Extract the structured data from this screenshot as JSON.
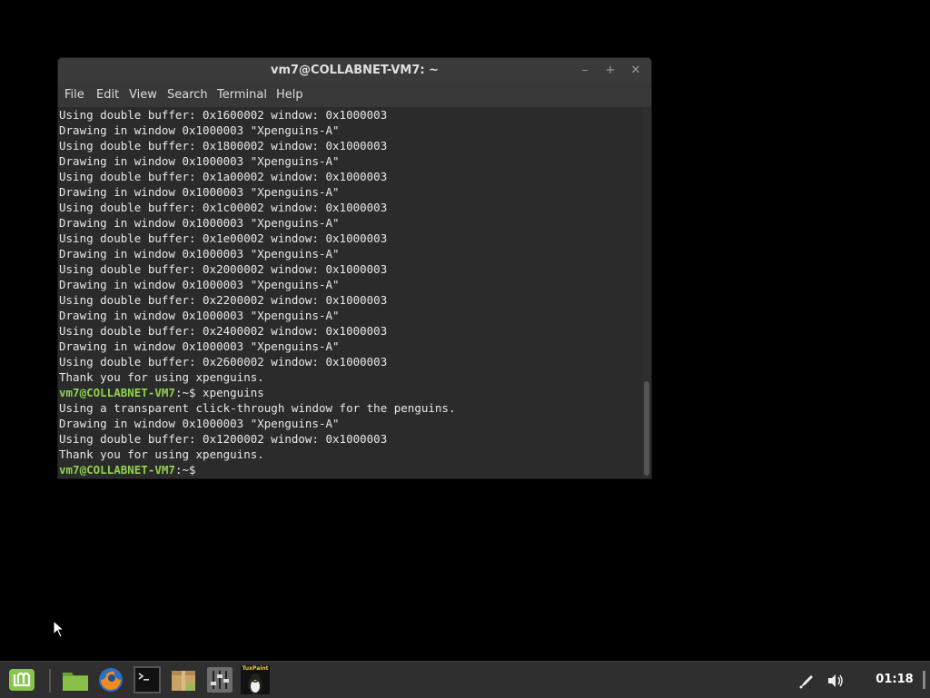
{
  "window": {
    "title": "vm7@COLLABNET-VM7: ~",
    "controls": {
      "minimize": "–",
      "maximize": "+",
      "close": "✕"
    }
  },
  "menu": [
    "File",
    "Edit",
    "View",
    "Search",
    "Terminal",
    "Help"
  ],
  "terminal": {
    "lines": [
      {
        "prompt": "",
        "text": "Using double buffer: 0x1600002 window: 0x1000003"
      },
      {
        "prompt": "",
        "text": "Drawing in window 0x1000003 \"Xpenguins-A\""
      },
      {
        "prompt": "",
        "text": "Using double buffer: 0x1800002 window: 0x1000003"
      },
      {
        "prompt": "",
        "text": "Drawing in window 0x1000003 \"Xpenguins-A\""
      },
      {
        "prompt": "",
        "text": "Using double buffer: 0x1a00002 window: 0x1000003"
      },
      {
        "prompt": "",
        "text": "Drawing in window 0x1000003 \"Xpenguins-A\""
      },
      {
        "prompt": "",
        "text": "Using double buffer: 0x1c00002 window: 0x1000003"
      },
      {
        "prompt": "",
        "text": "Drawing in window 0x1000003 \"Xpenguins-A\""
      },
      {
        "prompt": "",
        "text": "Using double buffer: 0x1e00002 window: 0x1000003"
      },
      {
        "prompt": "",
        "text": "Drawing in window 0x1000003 \"Xpenguins-A\""
      },
      {
        "prompt": "",
        "text": "Using double buffer: 0x2000002 window: 0x1000003"
      },
      {
        "prompt": "",
        "text": "Drawing in window 0x1000003 \"Xpenguins-A\""
      },
      {
        "prompt": "",
        "text": "Using double buffer: 0x2200002 window: 0x1000003"
      },
      {
        "prompt": "",
        "text": "Drawing in window 0x1000003 \"Xpenguins-A\""
      },
      {
        "prompt": "",
        "text": "Using double buffer: 0x2400002 window: 0x1000003"
      },
      {
        "prompt": "",
        "text": "Drawing in window 0x1000003 \"Xpenguins-A\""
      },
      {
        "prompt": "",
        "text": "Using double buffer: 0x2600002 window: 0x1000003"
      },
      {
        "prompt": "",
        "text": "Thank you for using xpenguins."
      },
      {
        "prompt": "vm7@COLLABNET-VM7",
        "text": ":~$ xpenguins"
      },
      {
        "prompt": "",
        "text": "Using a transparent click-through window for the penguins."
      },
      {
        "prompt": "",
        "text": "Drawing in window 0x1000003 \"Xpenguins-A\""
      },
      {
        "prompt": "",
        "text": "Using double buffer: 0x1200002 window: 0x1000003"
      },
      {
        "prompt": "",
        "text": "Thank you for using xpenguins."
      },
      {
        "prompt": "vm7@COLLABNET-VM7",
        "text": ":~$"
      }
    ]
  },
  "taskbar": {
    "launchers": [
      "mint-menu-icon",
      "files-icon",
      "firefox-icon",
      "terminal-icon",
      "archive-manager-icon",
      "settings-mixer-icon",
      "tuxpaint-icon"
    ],
    "tuxpaint_label": "TuxPaint",
    "clock": "01:18"
  },
  "colors": {
    "prompt": "#8fd14f",
    "terminal_bg": "#2b2b2b",
    "taskbar_bg": "#2f2f2f",
    "mint_green": "#87c54d"
  }
}
